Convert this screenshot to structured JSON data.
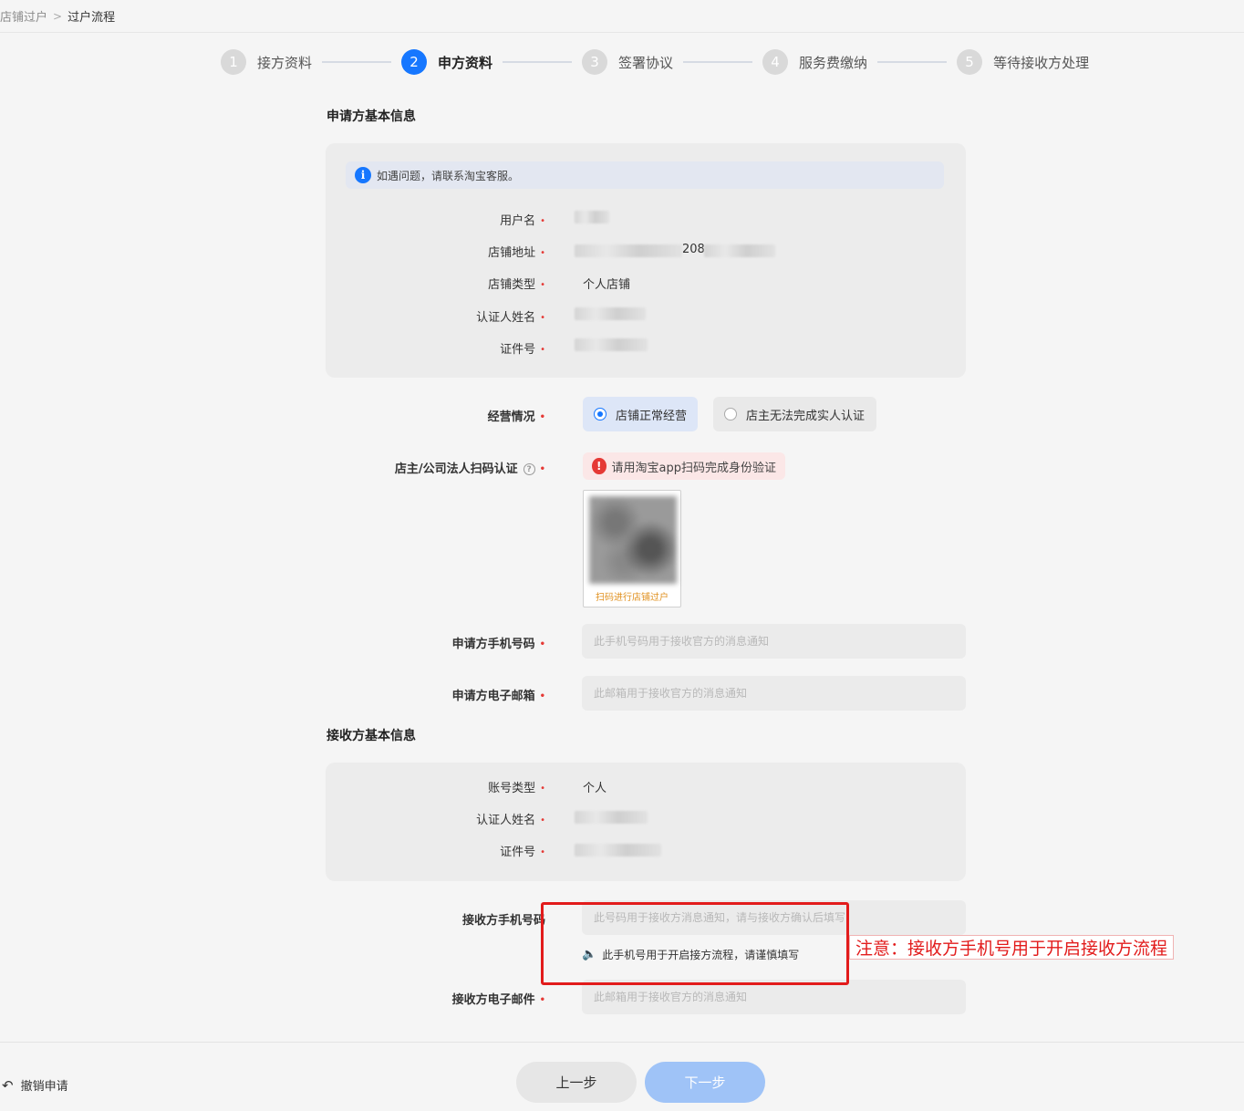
{
  "breadcrumb": {
    "parent": "店铺过户",
    "current": "过户流程"
  },
  "steps": [
    {
      "num": "1",
      "label": "接方资料"
    },
    {
      "num": "2",
      "label": "申方资料"
    },
    {
      "num": "3",
      "label": "签署协议"
    },
    {
      "num": "4",
      "label": "服务费缴纳"
    },
    {
      "num": "5",
      "label": "等待接收方处理"
    }
  ],
  "applicant": {
    "title": "申请方基本信息",
    "notice": "如遇问题，请联系淘宝客服。",
    "fields": {
      "username_label": "用户名",
      "shop_url_label": "店铺地址",
      "shop_url_partial": "208",
      "shop_type_label": "店铺类型",
      "shop_type_value": "个人店铺",
      "name_label": "认证人姓名",
      "id_label": "证件号"
    },
    "operation_label": "经营情况",
    "operation_options": [
      "店铺正常经营",
      "店主无法完成实人认证"
    ],
    "operation_selected": 0,
    "scan_label": "店主/公司法人扫码认证",
    "scan_warning": "请用淘宝app扫码完成身份验证",
    "qr_caption": "扫码进行店铺过户",
    "phone_label": "申请方手机号码",
    "phone_placeholder": "此手机号码用于接收官方的消息通知",
    "email_label": "申请方电子邮箱",
    "email_placeholder": "此邮箱用于接收官方的消息通知"
  },
  "receiver": {
    "title": "接收方基本信息",
    "account_type_label": "账号类型",
    "account_type_value": "个人",
    "name_label": "认证人姓名",
    "id_label": "证件号",
    "phone_label": "接收方手机号码",
    "phone_placeholder": "此号码用于接收方消息通知，请与接收方确认后填写",
    "phone_tip": "此手机号用于开启接方流程，请谨慎填写",
    "email_label": "接收方电子邮件",
    "email_placeholder": "此邮箱用于接收官方的消息通知"
  },
  "annotation": "注意：接收方手机号用于开启接收方流程",
  "footer": {
    "revoke": "撤销申请",
    "prev": "上一步",
    "next": "下一步"
  },
  "colors": {
    "primary": "#1677ff",
    "danger": "#e21b1b",
    "next_disabled": "#9fc3f7"
  }
}
